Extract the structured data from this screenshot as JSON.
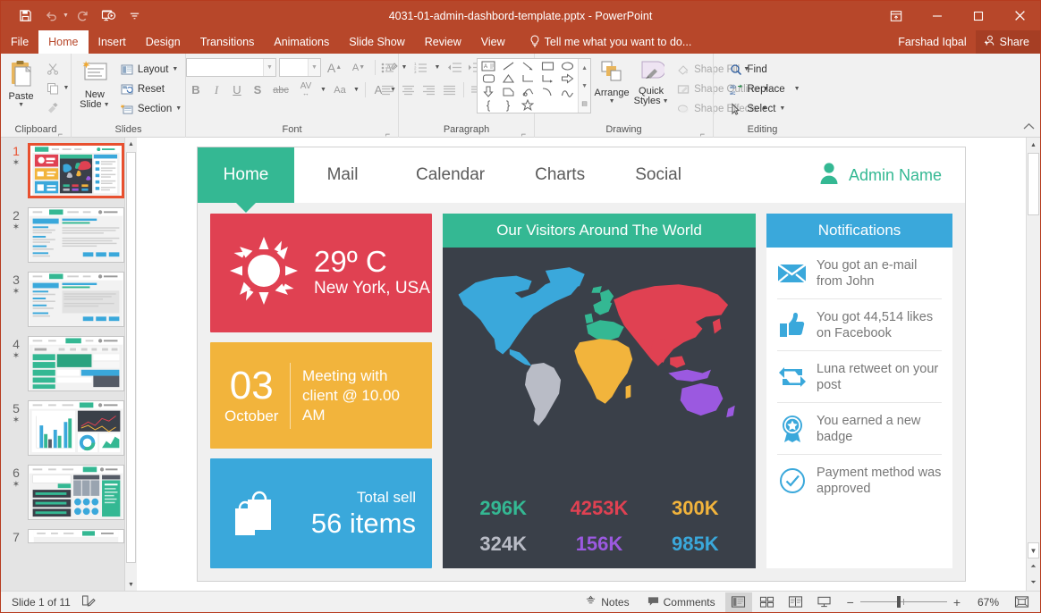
{
  "titlebar": {
    "document_title": "4031-01-admin-dashbord-template.pptx - PowerPoint",
    "qat": [
      {
        "name": "save-icon",
        "label": "Save"
      },
      {
        "name": "undo-icon",
        "label": "Undo"
      },
      {
        "name": "redo-icon",
        "label": "Redo"
      },
      {
        "name": "start-presentation-icon",
        "label": "Start From Beginning"
      },
      {
        "name": "customize-qat-icon",
        "label": "Customize Quick Access Toolbar"
      }
    ],
    "window_controls": [
      {
        "name": "ribbon-display-options-icon",
        "label": "Ribbon Display Options"
      },
      {
        "name": "minimize-icon",
        "label": "Minimize"
      },
      {
        "name": "restore-icon",
        "label": "Restore Down"
      },
      {
        "name": "close-icon",
        "label": "Close"
      }
    ]
  },
  "ribbon_tabs": {
    "items": [
      "File",
      "Home",
      "Insert",
      "Design",
      "Transitions",
      "Animations",
      "Slide Show",
      "Review",
      "View"
    ],
    "active": "Home",
    "tell_me": "Tell me what you want to do...",
    "account_name": "Farshad Iqbal",
    "share_label": "Share"
  },
  "ribbon": {
    "groups": [
      {
        "label": "Clipboard"
      },
      {
        "label": "Slides"
      },
      {
        "label": "Font"
      },
      {
        "label": "Paragraph"
      },
      {
        "label": "Drawing"
      },
      {
        "label": "Editing"
      }
    ],
    "clipboard": {
      "paste_label": "Paste",
      "cut_label": "Cut",
      "copy_label": "Copy",
      "format_painter_label": "Format Painter"
    },
    "slides": {
      "new_slide_line1": "New",
      "new_slide_line2": "Slide",
      "layout_label": "Layout",
      "reset_label": "Reset",
      "section_label": "Section"
    },
    "font": {
      "font_name_value": "",
      "font_name_placeholder": "",
      "font_size_value": "",
      "font_size_placeholder": "",
      "increase_size_label": "A",
      "decrease_size_label": "A",
      "clear_formatting_label": "Clear All Formatting",
      "bold_label": "B",
      "italic_label": "I",
      "underline_label": "U",
      "shadow_label": "S",
      "strikethrough_label": "abc",
      "char_spacing_label": "AV",
      "change_case_label": "Aa",
      "font_color_label": "A"
    },
    "drawing": {
      "arrange_label": "Arrange",
      "quick_styles_line1": "Quick",
      "quick_styles_line2": "Styles",
      "shape_fill_label": "Shape Fill",
      "shape_outline_label": "Shape Outline",
      "shape_effects_label": "Shape Effects"
    },
    "editing": {
      "find_label": "Find",
      "replace_label": "Replace",
      "select_label": "Select"
    }
  },
  "thumbnails": {
    "selected_index": 1,
    "items": [
      {
        "number": "1",
        "starred": true
      },
      {
        "number": "2",
        "starred": true
      },
      {
        "number": "3",
        "starred": true
      },
      {
        "number": "4",
        "starred": true
      },
      {
        "number": "5",
        "starred": true
      },
      {
        "number": "6",
        "starred": true
      },
      {
        "number": "7",
        "starred": true
      }
    ]
  },
  "slide": {
    "nav": {
      "tabs": [
        "Home",
        "Mail",
        "Calendar",
        "Charts",
        "Social"
      ],
      "active_tab": "Home",
      "admin_name": "Admin Name",
      "avatar_icon": "user-avatar-icon"
    },
    "weather_card": {
      "icon": "sun-icon",
      "temperature": "29º C",
      "location": "New York, USA",
      "color": "#e04152"
    },
    "calendar_card": {
      "day": "03",
      "month": "October",
      "text": "Meeting with client @ 10.00 AM",
      "color": "#f2b43c"
    },
    "sales_card": {
      "icon": "shopping-bags-icon",
      "label": "Total sell",
      "value": "56 items",
      "color": "#3aa8db"
    },
    "map_card": {
      "title": "Our Visitors Around The World",
      "header_color": "#34b893",
      "body_color": "#3a4049",
      "regions": [
        {
          "name": "North America",
          "color": "#3aa8db"
        },
        {
          "name": "South America",
          "color": "#b9bcc6"
        },
        {
          "name": "Europe",
          "color": "#34b893"
        },
        {
          "name": "Africa",
          "color": "#f2b43c"
        },
        {
          "name": "Asia",
          "color": "#e04152"
        },
        {
          "name": "Australia",
          "color": "#9b59e0"
        }
      ],
      "stats": [
        {
          "value": "296K",
          "color": "#34b893"
        },
        {
          "value": "4253K",
          "color": "#e04152"
        },
        {
          "value": "300K",
          "color": "#f2b43c"
        },
        {
          "value": "324K",
          "color": "#b9bcc6"
        },
        {
          "value": "156K",
          "color": "#9b59e0"
        },
        {
          "value": "985K",
          "color": "#3aa8db"
        }
      ]
    },
    "notifications_card": {
      "title": "Notifications",
      "header_color": "#3aa8db",
      "items": [
        {
          "icon": "envelope-icon",
          "text": "You got an e-mail from John"
        },
        {
          "icon": "thumbs-up-icon",
          "text": "You got 44,514 likes on Facebook"
        },
        {
          "icon": "retweet-icon",
          "text": "Luna retweet on your post"
        },
        {
          "icon": "badge-icon",
          "text": "You earned a new badge"
        },
        {
          "icon": "check-circle-icon",
          "text": "Payment method was approved"
        }
      ]
    }
  },
  "statusbar": {
    "slide_count_text": "Slide 1 of 11",
    "notes_icon_name": "slide-notes-icon",
    "notes_label": "Notes",
    "comments_label": "Comments",
    "views": [
      {
        "name": "normal-view-icon",
        "label": "Normal",
        "active": true
      },
      {
        "name": "slide-sorter-icon",
        "label": "Slide Sorter",
        "active": false
      },
      {
        "name": "reading-view-icon",
        "label": "Reading View",
        "active": false
      },
      {
        "name": "slideshow-icon",
        "label": "Slide Show",
        "active": false
      }
    ],
    "zoom_out_label": "−",
    "zoom_in_label": "+",
    "zoom_percent": "67%",
    "fit_label": "Fit slide to current window"
  }
}
